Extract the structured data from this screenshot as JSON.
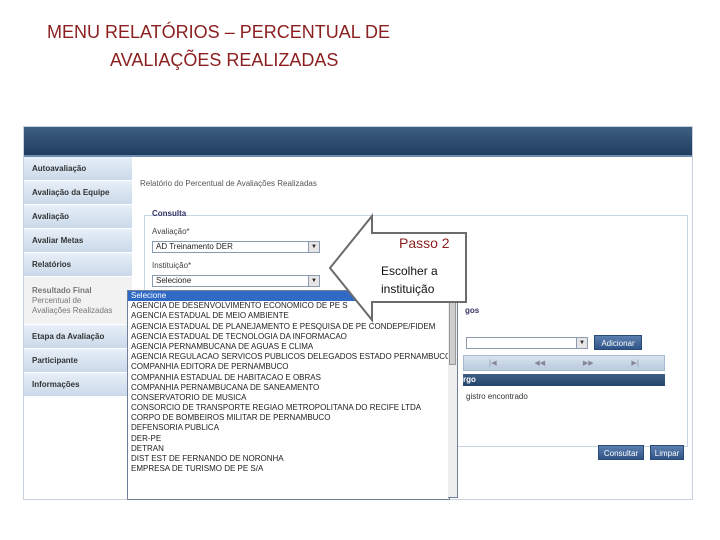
{
  "slide": {
    "title_line1": "MENU RELATÓRIOS – PERCENTUAL DE",
    "title_line2": "AVALIAÇÕES REALIZADAS"
  },
  "sidebar": {
    "items": [
      {
        "label": "Autoavaliação"
      },
      {
        "label": "Avaliação da Equipe"
      },
      {
        "label": "Avaliação"
      },
      {
        "label": "Avaliar Metas"
      },
      {
        "label": "Relatórios"
      },
      {
        "label": "Resultado Final",
        "sub1": "Percentual de",
        "sub2": "Avaliações Realizadas"
      },
      {
        "label": "Etapa da Avaliação"
      },
      {
        "label": "Participante"
      },
      {
        "label": "Informações"
      }
    ]
  },
  "main": {
    "heading": "Relatório do Percentual de Avaliações Realizadas",
    "fieldset_label": "Consulta",
    "avaliacao_label": "Avaliação*",
    "avaliacao_value": "AD Treinamento DER",
    "instituicao_label": "Instituição*",
    "instituicao_value": "Selecione",
    "section2_label": "gos",
    "add_button": "Adicionar",
    "pager": [
      "|◀",
      "◀◀",
      "▶▶",
      "▶|"
    ],
    "column_header": "rgo",
    "empty_message": "gistro encontrado",
    "consultar_button": "Consultar",
    "limpar_button": "Limpar"
  },
  "dropdown": {
    "options": [
      "Selecione",
      "AGENCIA DE DESENVOLVIMENTO ECONOMICO DE PE S",
      "AGENCIA ESTADUAL DE MEIO AMBIENTE",
      "AGENCIA ESTADUAL DE PLANEJAMENTO E PESQUISA DE PE CONDEPE/FIDEM",
      "AGENCIA ESTADUAL DE TECNOLOGIA DA INFORMACAO",
      "AGENCIA PERNAMBUCANA DE AGUAS E CLIMA",
      "AGENCIA REGULACAO SERVICOS PUBLICOS DELEGADOS ESTADO PERNAMBUCO",
      "COMPANHIA EDITORA DE PERNAMBUCO",
      "COMPANHIA ESTADUAL DE HABITACAO E OBRAS",
      "COMPANHIA PERNAMBUCANA DE SANEAMENTO",
      "CONSERVATORIO DE MUSICA",
      "CONSORCIO DE TRANSPORTE REGIAO METROPOLITANA DO RECIFE LTDA",
      "CORPO DE BOMBEIROS MILITAR DE PERNAMBUCO",
      "DEFENSORIA PUBLICA",
      "DER-PE",
      "DETRAN",
      "DIST EST DE FERNANDO DE NORONHA",
      "EMPRESA DE TURISMO DE PE S/A"
    ]
  },
  "callout": {
    "title": "Passo 2",
    "text": "Escolher a instituição"
  }
}
